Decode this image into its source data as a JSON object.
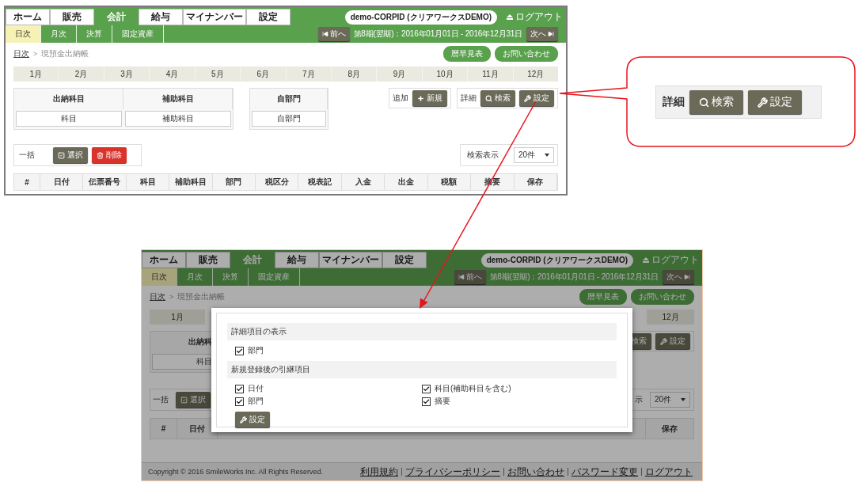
{
  "top_screen": {
    "nav_tabs": [
      {
        "label": "ホーム",
        "selected": false
      },
      {
        "label": "販売",
        "selected": false
      },
      {
        "label": "会計",
        "selected": true
      },
      {
        "label": "給与",
        "selected": false
      },
      {
        "label": "マイナンバー",
        "selected": false
      },
      {
        "label": "設定",
        "selected": false
      }
    ],
    "sub_tabs": [
      {
        "label": "日次",
        "selected": true
      },
      {
        "label": "月次",
        "selected": false
      },
      {
        "label": "決算",
        "selected": false
      },
      {
        "label": "固定資産",
        "selected": false
      }
    ],
    "account": "demo-CORPID (クリアワークスDEMO)",
    "logout": "ログアウト",
    "prev": "前へ",
    "period": "第8期(翌期)：2016年01月01日 - 2016年12月31日",
    "next": "次へ",
    "breadcrumb": {
      "link": "日次",
      "separator": ">",
      "current": "現預金出納帳"
    },
    "header_links": [
      "暦早見表",
      "お問い合わせ"
    ],
    "months": [
      "1月",
      "2月",
      "3月",
      "4月",
      "5月",
      "6月",
      "7月",
      "8月",
      "9月",
      "10月",
      "11月",
      "12月"
    ],
    "account_filter": [
      {
        "header": "出納科目",
        "value": "科目"
      },
      {
        "header": "補助科目",
        "value": "補助科目"
      }
    ],
    "dept_filter": {
      "header": "自部門",
      "value": "自部門"
    },
    "add": {
      "label": "追加",
      "button": "新規"
    },
    "detail": {
      "label": "詳細",
      "buttons": [
        {
          "label": "検索",
          "kind": "search"
        },
        {
          "label": "設定",
          "kind": "settings"
        }
      ]
    },
    "bulk": {
      "label": "一括",
      "buttons": [
        {
          "label": "選択",
          "kind": "select"
        },
        {
          "label": "削除",
          "kind": "delete"
        }
      ]
    },
    "display": {
      "label": "検索表示",
      "value": "20件"
    },
    "columns": [
      "#",
      "日付",
      "伝票番号",
      "科目",
      "補助科目",
      "部門",
      "税区分",
      "税表記",
      "入金",
      "出金",
      "税額",
      "摘要",
      "保存"
    ]
  },
  "callout": {
    "label": "詳細",
    "buttons": [
      {
        "label": "検索",
        "kind": "search"
      },
      {
        "label": "設定",
        "kind": "settings"
      }
    ]
  },
  "bottom_screen": {
    "nav_tabs": [
      {
        "label": "ホーム",
        "selected": false
      },
      {
        "label": "販売",
        "selected": false
      },
      {
        "label": "会計",
        "selected": true
      },
      {
        "label": "給与",
        "selected": false
      },
      {
        "label": "マイナンバー",
        "selected": false
      },
      {
        "label": "設定",
        "selected": false
      }
    ],
    "sub_tabs": [
      {
        "label": "日次",
        "selected": true
      },
      {
        "label": "月次",
        "selected": false
      },
      {
        "label": "決算",
        "selected": false
      },
      {
        "label": "固定資産",
        "selected": false
      }
    ],
    "account": "demo-CORPID (クリアワークスDEMO)",
    "logout": "ログアウト",
    "prev": "前へ",
    "period": "第8期(翌期)：2016年01月01日 - 2016年12月31日",
    "next": "次へ",
    "breadcrumb": {
      "link": "日次",
      "separator": ">",
      "current": "現預金出納帳"
    },
    "header_links": [
      "暦早見表",
      "お問い合わせ"
    ],
    "months": [
      "1月",
      "12月"
    ],
    "account_filter": {
      "header": "出納科",
      "value": "科目"
    },
    "detail_buttons": [
      {
        "label": "検索",
        "kind": "search"
      },
      {
        "label": "設定",
        "kind": "settings"
      }
    ],
    "bulk": {
      "label": "一括",
      "button": {
        "label": "選択",
        "kind": "select"
      }
    },
    "display": {
      "label": "示",
      "value": "20件"
    },
    "columns": [
      "#",
      "日付",
      "保存"
    ],
    "copyright": "Copyright © 2016 SmileWorks Inc. All Rights Reserved.",
    "footer_links": [
      "利用規約",
      "プライバシーポリシー",
      "お問い合わせ",
      "パスワード変更",
      "ログアウト"
    ]
  },
  "dialog": {
    "sections": [
      {
        "title": "詳細項目の表示",
        "options": [
          {
            "label": "部門",
            "checked": true
          }
        ]
      },
      {
        "title": "新規登録後の引継項目",
        "options": [
          {
            "label": "日付",
            "checked": true
          },
          {
            "label": "科目(補助科目を含む)",
            "checked": true
          },
          {
            "label": "部門",
            "checked": true
          },
          {
            "label": "摘要",
            "checked": true
          }
        ]
      }
    ],
    "button": "設定"
  }
}
